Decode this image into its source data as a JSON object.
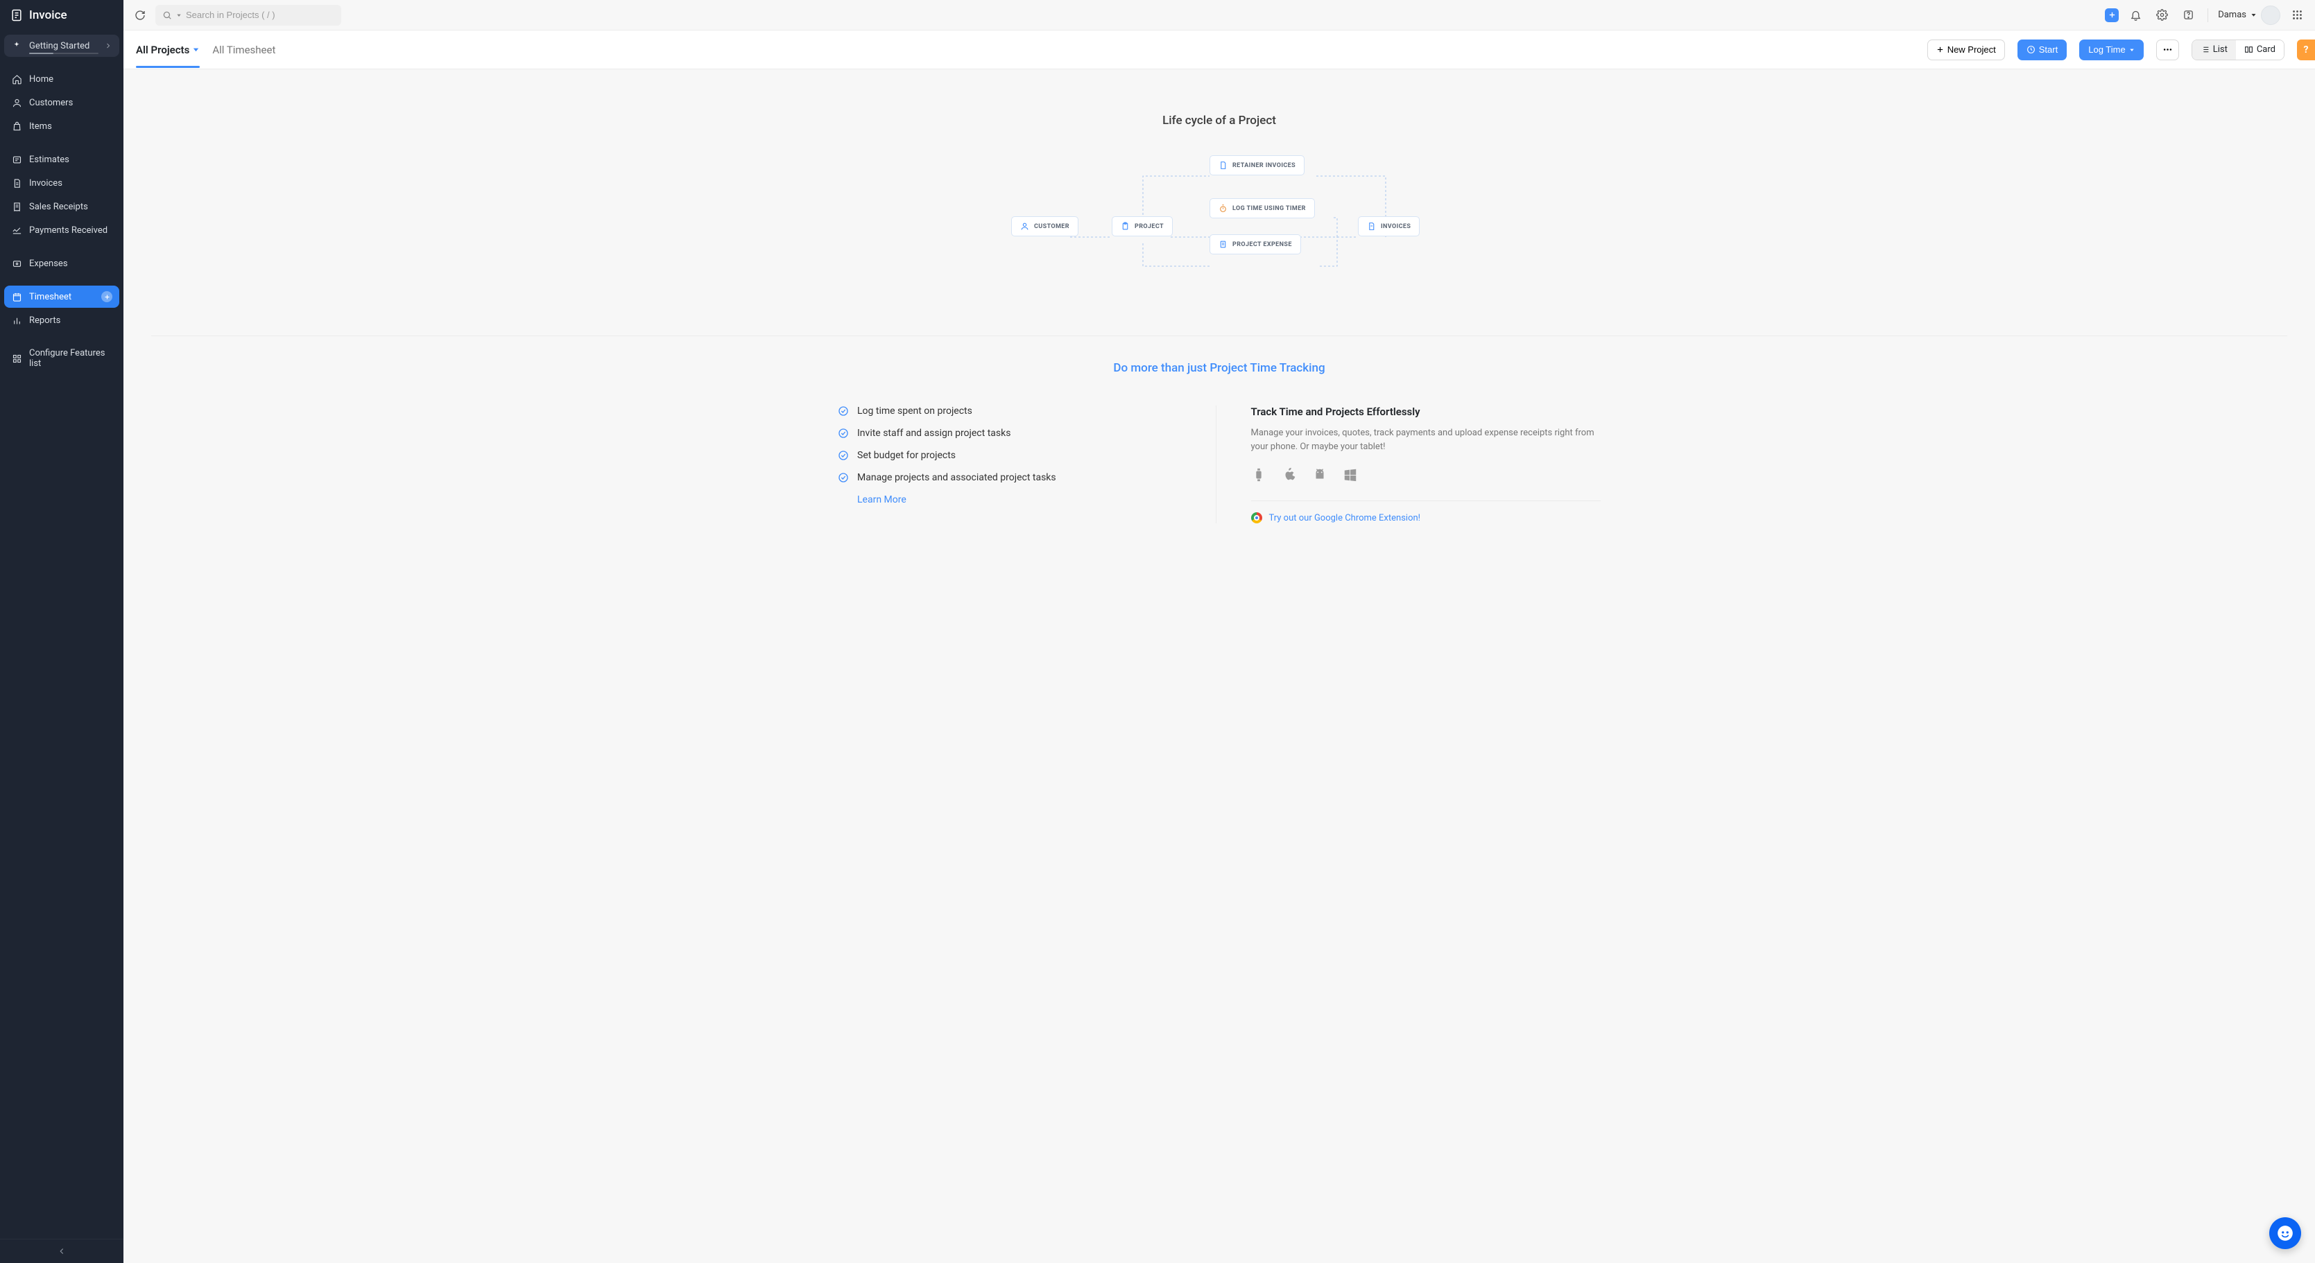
{
  "app": {
    "title": "Invoice"
  },
  "sidebar": {
    "getting_started": "Getting Started",
    "items": {
      "home": "Home",
      "customers": "Customers",
      "items": "Items",
      "estimates": "Estimates",
      "invoices": "Invoices",
      "sales_receipts": "Sales Receipts",
      "payments_received": "Payments Received",
      "expenses": "Expenses",
      "timesheet": "Timesheet",
      "reports": "Reports",
      "configure": "Configure Features list"
    }
  },
  "topbar": {
    "search_placeholder": "Search in Projects ( / )",
    "username": "Damas"
  },
  "subheader": {
    "tabs": {
      "all_projects": "All Projects",
      "all_timesheet": "All Timesheet"
    },
    "buttons": {
      "new_project": "New Project",
      "start": "Start",
      "log_time": "Log Time",
      "list": "List",
      "card": "Card"
    }
  },
  "content": {
    "lifecycle_heading": "Life cycle of a Project",
    "diagram": {
      "customer": "CUSTOMER",
      "project": "PROJECT",
      "retainer": "RETAINER INVOICES",
      "logtime": "LOG TIME USING TIMER",
      "expense": "PROJECT EXPENSE",
      "invoices": "INVOICES"
    },
    "dothan_heading": "Do more than just Project Time Tracking",
    "features": {
      "f1": "Log time spent on projects",
      "f2": "Invite staff and assign project tasks",
      "f3": "Set budget for projects",
      "f4": "Manage projects and associated project tasks",
      "learn_more": "Learn More"
    },
    "track": {
      "title": "Track Time and Projects Effortlessly",
      "desc": "Manage your invoices, quotes, track payments and upload expense receipts right from your phone. Or maybe your tablet!",
      "chrome": "Try out our Google Chrome Extension!"
    }
  }
}
